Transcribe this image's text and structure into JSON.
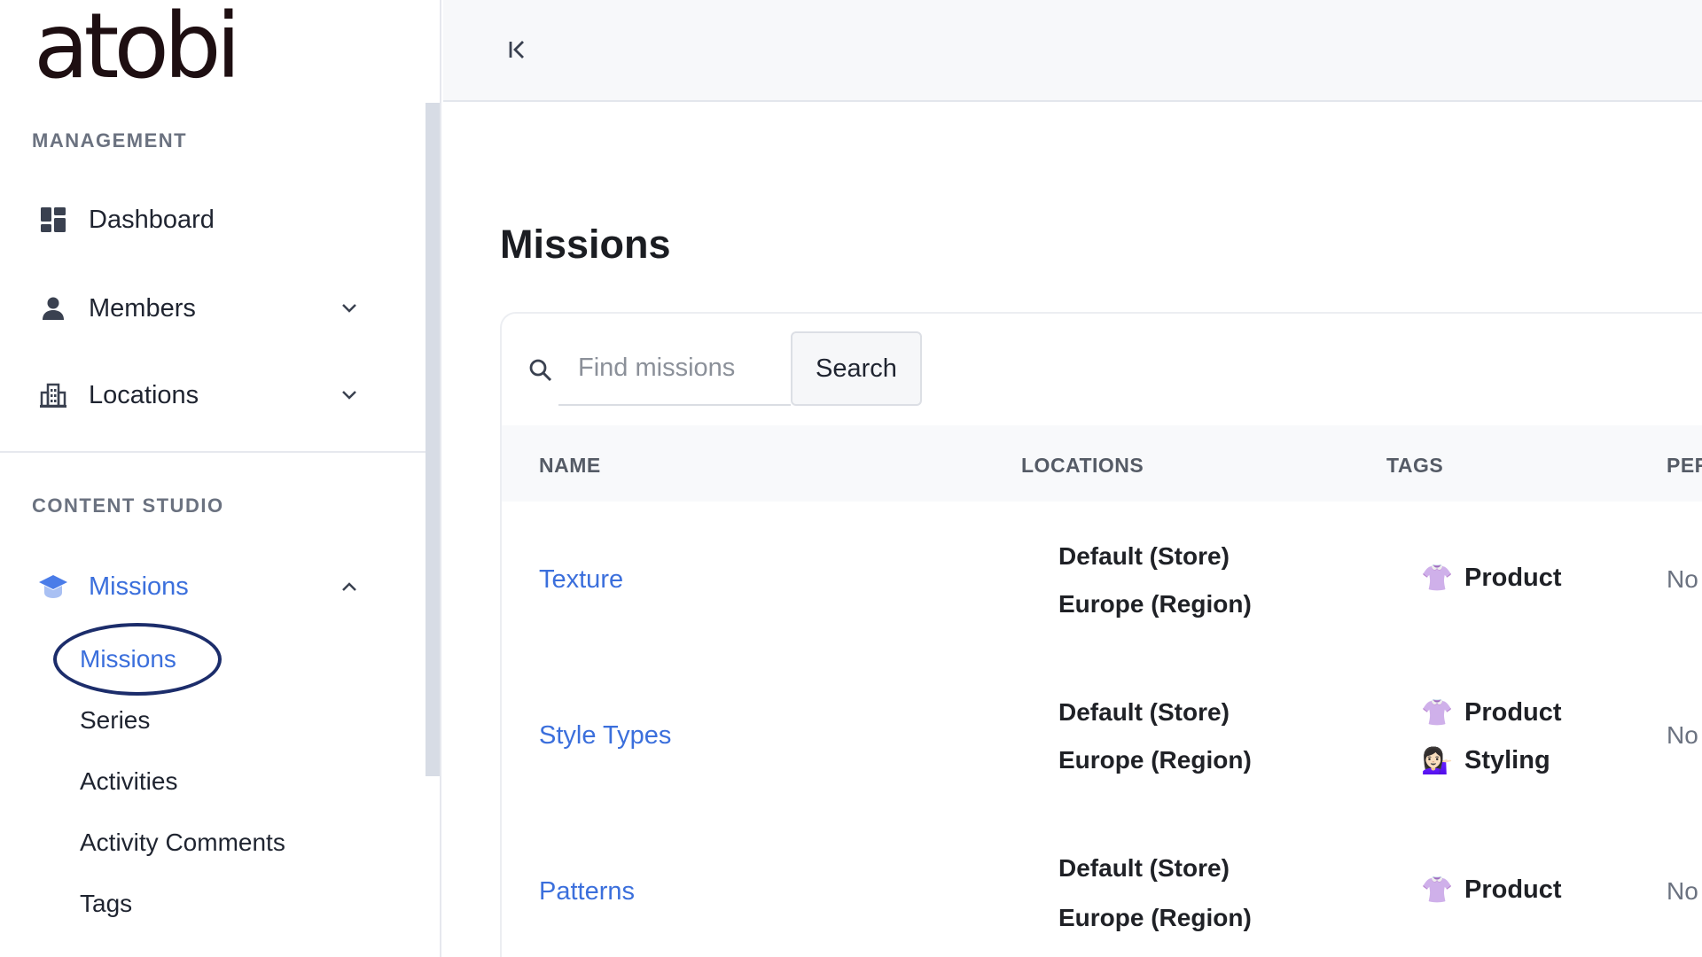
{
  "brand": {
    "logo_text": "atobi"
  },
  "sidebar": {
    "management_label": "MANAGEMENT",
    "content_studio_label": "CONTENT STUDIO",
    "items": [
      {
        "label": "Dashboard",
        "icon": "dashboard-icon"
      },
      {
        "label": "Members",
        "icon": "person-icon",
        "expandable": true
      },
      {
        "label": "Locations",
        "icon": "building-icon",
        "expandable": true
      },
      {
        "label": "Missions",
        "icon": "graduation-cap-icon",
        "expanded": true,
        "active": true
      }
    ],
    "missions_sub": [
      {
        "label": "Missions",
        "active": true
      },
      {
        "label": "Series"
      },
      {
        "label": "Activities"
      },
      {
        "label": "Activity Comments"
      },
      {
        "label": "Tags"
      }
    ]
  },
  "main": {
    "title": "Missions",
    "search": {
      "placeholder": "Find missions",
      "button_label": "Search"
    },
    "table": {
      "columns": [
        "NAME",
        "LOCATIONS",
        "TAGS",
        "PER"
      ],
      "rows": [
        {
          "name": "Texture",
          "locations": [
            "Default (Store)",
            "Europe (Region)"
          ],
          "tags": [
            {
              "emoji": "👚",
              "label": "Product"
            }
          ],
          "per": "No"
        },
        {
          "name": "Style Types",
          "locations": [
            "Default (Store)",
            "Europe (Region)"
          ],
          "tags": [
            {
              "emoji": "👚",
              "label": "Product"
            },
            {
              "emoji": "💁🏻‍♀️",
              "label": "Styling"
            }
          ],
          "per": "No"
        },
        {
          "name": "Patterns",
          "locations": [
            "Default (Store)",
            "Europe (Region)"
          ],
          "tags": [
            {
              "emoji": "👚",
              "label": "Product"
            }
          ],
          "per": "No"
        }
      ]
    }
  }
}
